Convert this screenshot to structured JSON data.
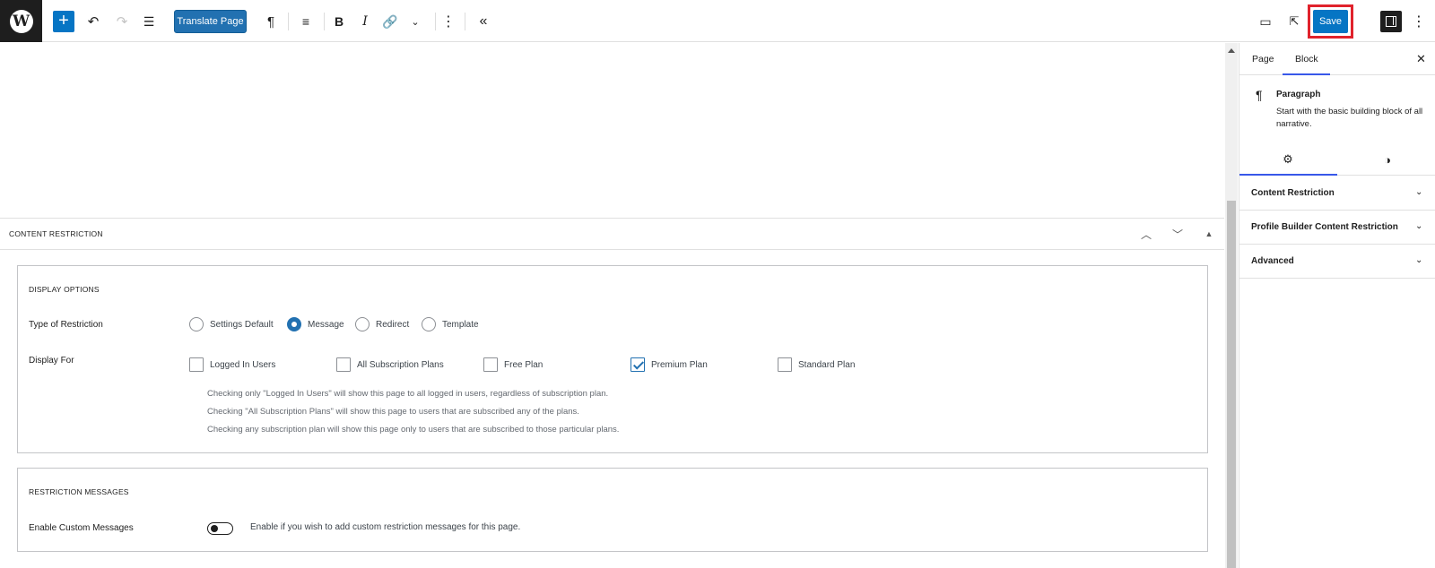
{
  "toolbar": {
    "translate_label": "Translate Page",
    "save_label": "Save"
  },
  "metabox": {
    "title": "CONTENT RESTRICTION",
    "display_options": {
      "title": "DISPLAY OPTIONS",
      "type_label": "Type of Restriction",
      "types": [
        "Settings Default",
        "Message",
        "Redirect",
        "Template"
      ],
      "selected_type": "Message",
      "display_for_label": "Display For",
      "display_for": [
        {
          "label": "Logged In Users",
          "checked": false
        },
        {
          "label": "All Subscription Plans",
          "checked": false
        },
        {
          "label": "Free Plan",
          "checked": false
        },
        {
          "label": "Premium Plan",
          "checked": true
        },
        {
          "label": "Standard Plan",
          "checked": false
        }
      ],
      "help": [
        "Checking only \"Logged In Users\" will show this page to all logged in users, regardless of subscription plan.",
        "Checking \"All Subscription Plans\" will show this page to users that are subscribed any of the plans.",
        "Checking any subscription plan will show this page only to users that are subscribed to those particular plans."
      ]
    },
    "messages": {
      "title": "RESTRICTION MESSAGES",
      "enable_label": "Enable Custom Messages",
      "enable_desc": "Enable if you wish to add custom restriction messages for this page.",
      "enabled": false
    }
  },
  "sidebar": {
    "tabs": [
      "Page",
      "Block"
    ],
    "active_tab": "Block",
    "block_name": "Paragraph",
    "block_desc": "Start with the basic building block of all narrative.",
    "sections": [
      "Content Restriction",
      "Profile Builder Content Restriction",
      "Advanced"
    ]
  },
  "colors": {
    "accent": "#0675c4",
    "highlight": "#e0222c",
    "wp_blue": "#2271b1"
  }
}
